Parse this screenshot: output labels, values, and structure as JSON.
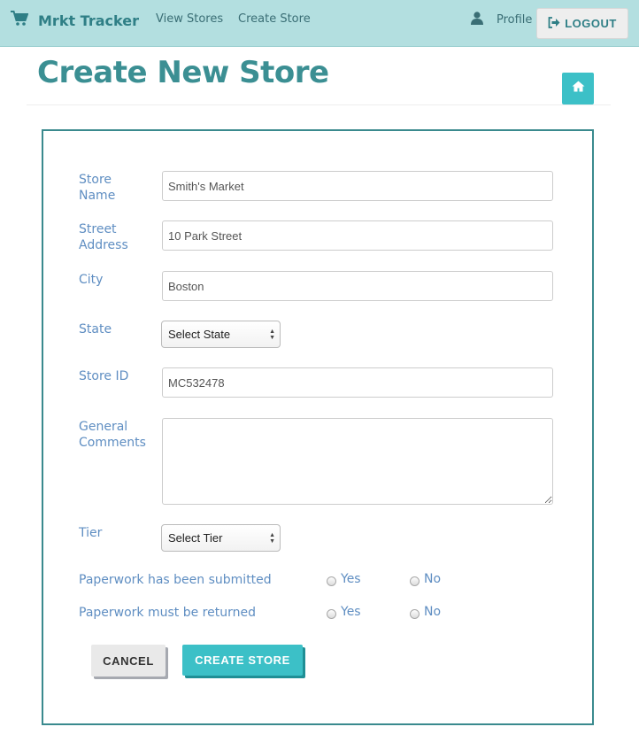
{
  "nav": {
    "brand": "Mrkt Tracker",
    "links": [
      "View Stores",
      "Create Store"
    ],
    "profile": "Profile",
    "logout": "LOGOUT"
  },
  "page": {
    "title": "Create New Store"
  },
  "form": {
    "labels": {
      "store_name": [
        "Store",
        "Name"
      ],
      "street_address": [
        "Street",
        "Address"
      ],
      "city": "City",
      "state": "State",
      "store_id": "Store ID",
      "comments": [
        "General",
        "Comments"
      ],
      "tier": "Tier",
      "paperwork_submitted": "Paperwork has been submitted",
      "paperwork_returned": "Paperwork must be returned"
    },
    "values": {
      "store_name": "Smith's Market",
      "street_address": "10 Park Street",
      "city": "Boston",
      "store_id": "MC532478",
      "comments": ""
    },
    "state_select": "Select State",
    "tier_select": "Select Tier",
    "radio_yes": "Yes",
    "radio_no": "No",
    "cancel": "CANCEL",
    "submit": "CREATE STORE"
  },
  "icons": {
    "brand": "shopping-cart-icon",
    "profile": "user-icon",
    "logout": "sign-out-icon",
    "home": "home-icon"
  },
  "colors": {
    "navbar": "#b3dfe0",
    "title": "#3b8f93",
    "accent": "#3cc0c7",
    "label": "#5f8ec2",
    "panel_border": "#3a8a8e"
  }
}
